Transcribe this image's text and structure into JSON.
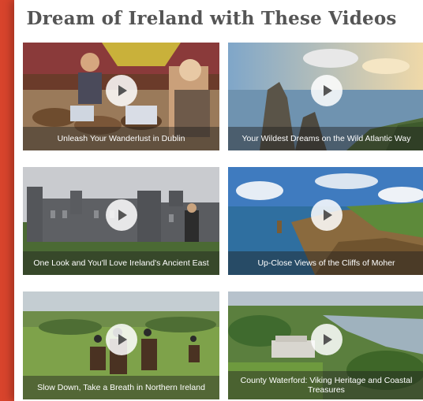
{
  "page": {
    "title": "Dream of Ireland with These Videos"
  },
  "videos": [
    {
      "caption": "Unleash Your Wanderlust in Dublin",
      "icon": "play-icon"
    },
    {
      "caption": "Your Wildest Dreams on the Wild Atlantic Way",
      "icon": "play-icon"
    },
    {
      "caption": "One Look and You'll Love Ireland's Ancient East",
      "icon": "play-icon"
    },
    {
      "caption": "Up-Close Views of the Cliffs of Moher",
      "icon": "play-icon"
    },
    {
      "caption": "Slow Down, Take a Breath in Northern Ireland",
      "icon": "play-icon"
    },
    {
      "caption": "County Waterford: Viking Heritage and Coastal Treasures",
      "icon": "play-icon"
    }
  ],
  "colors": {
    "background": "#d8442c",
    "panel": "#ffffff",
    "title": "#555555"
  }
}
